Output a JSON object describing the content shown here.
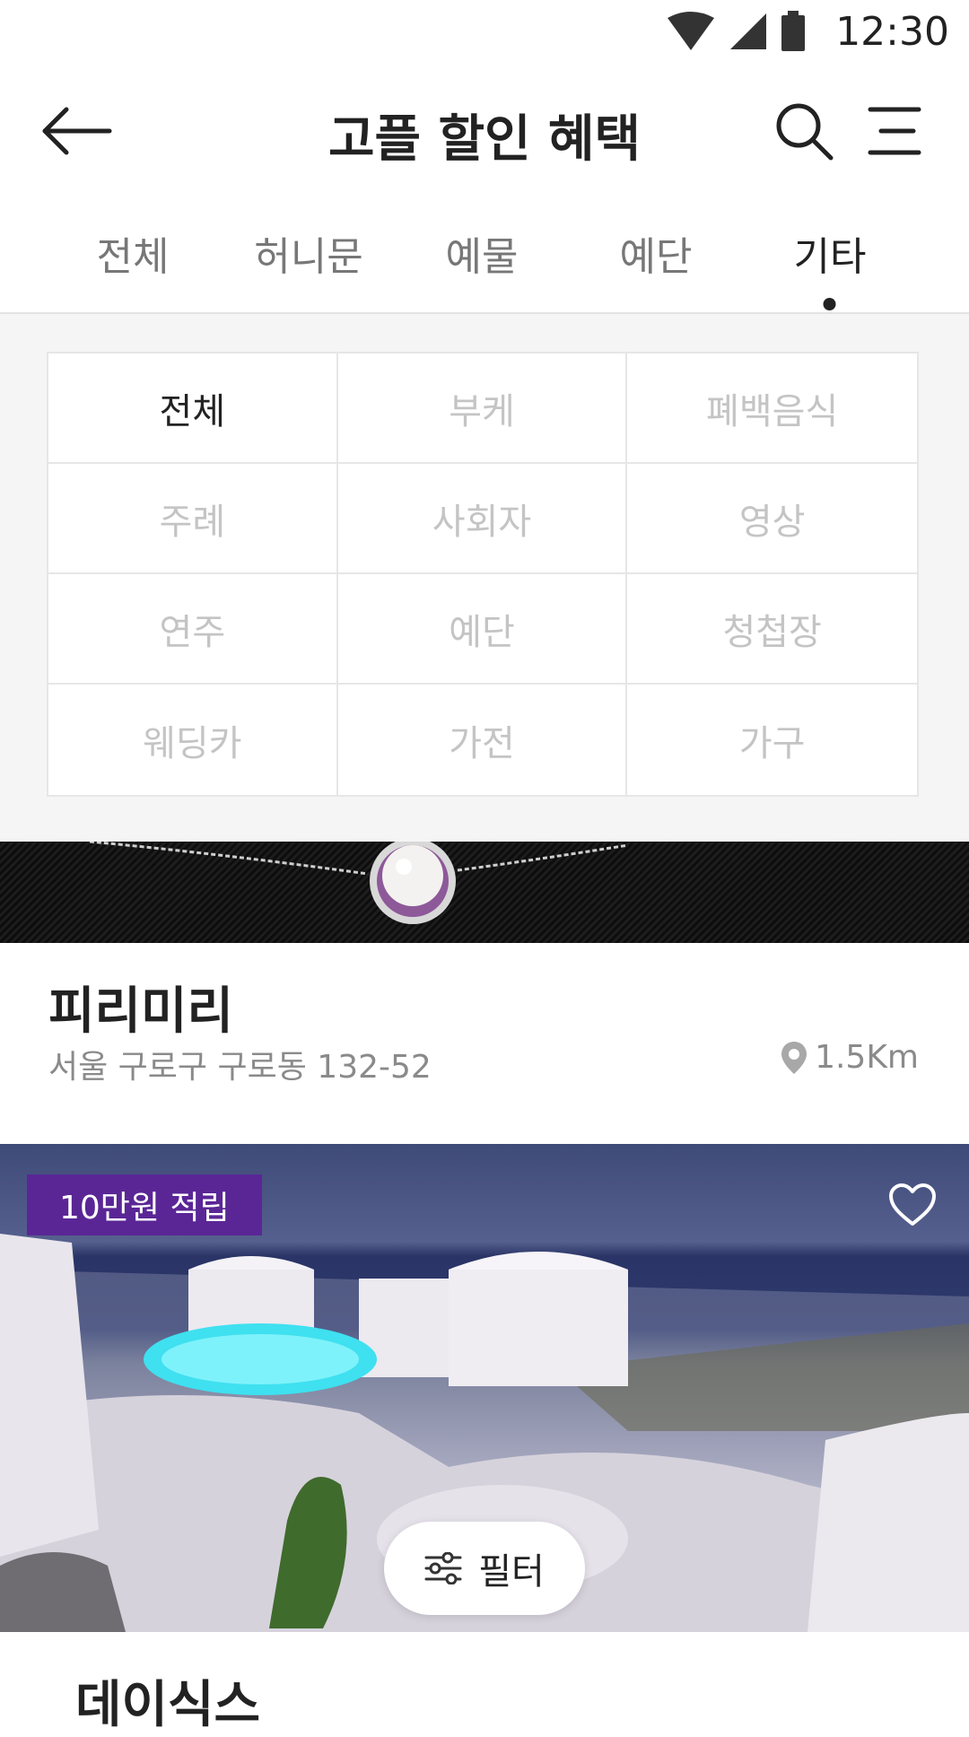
{
  "status_bar": {
    "time": "12:30",
    "icons": [
      "wifi-icon",
      "cellular-signal-icon",
      "battery-icon"
    ]
  },
  "app_bar": {
    "title": "고플 할인 혜택",
    "icons": [
      "back-arrow-icon",
      "search-icon",
      "menu-icon"
    ]
  },
  "tabs": [
    {
      "label": "전체",
      "active": false
    },
    {
      "label": "허니문",
      "active": false
    },
    {
      "label": "예물",
      "active": false
    },
    {
      "label": "예단",
      "active": false
    },
    {
      "label": "기타",
      "active": true
    }
  ],
  "subcategories": [
    {
      "label": "전체",
      "active": true
    },
    {
      "label": "부케",
      "active": false
    },
    {
      "label": "폐백음식",
      "active": false
    },
    {
      "label": "주례",
      "active": false
    },
    {
      "label": "사회자",
      "active": false
    },
    {
      "label": "영상",
      "active": false
    },
    {
      "label": "연주",
      "active": false
    },
    {
      "label": "예단",
      "active": false
    },
    {
      "label": "청첩장",
      "active": false
    },
    {
      "label": "웨딩카",
      "active": false
    },
    {
      "label": "가전",
      "active": false
    },
    {
      "label": "가구",
      "active": false
    }
  ],
  "cards": [
    {
      "name": "피리미리",
      "address": "서울 구로구 구로동 132-52",
      "distance": "1.5Km"
    },
    {
      "badge": "10만원 적립",
      "name": "데이식스"
    }
  ],
  "filter_button": {
    "label": "필터"
  },
  "colors": {
    "accent_purple": "#5a2696",
    "active_text": "#222222",
    "inactive_text": "#c4c4c4",
    "panel_bg": "#f5f5f5"
  }
}
